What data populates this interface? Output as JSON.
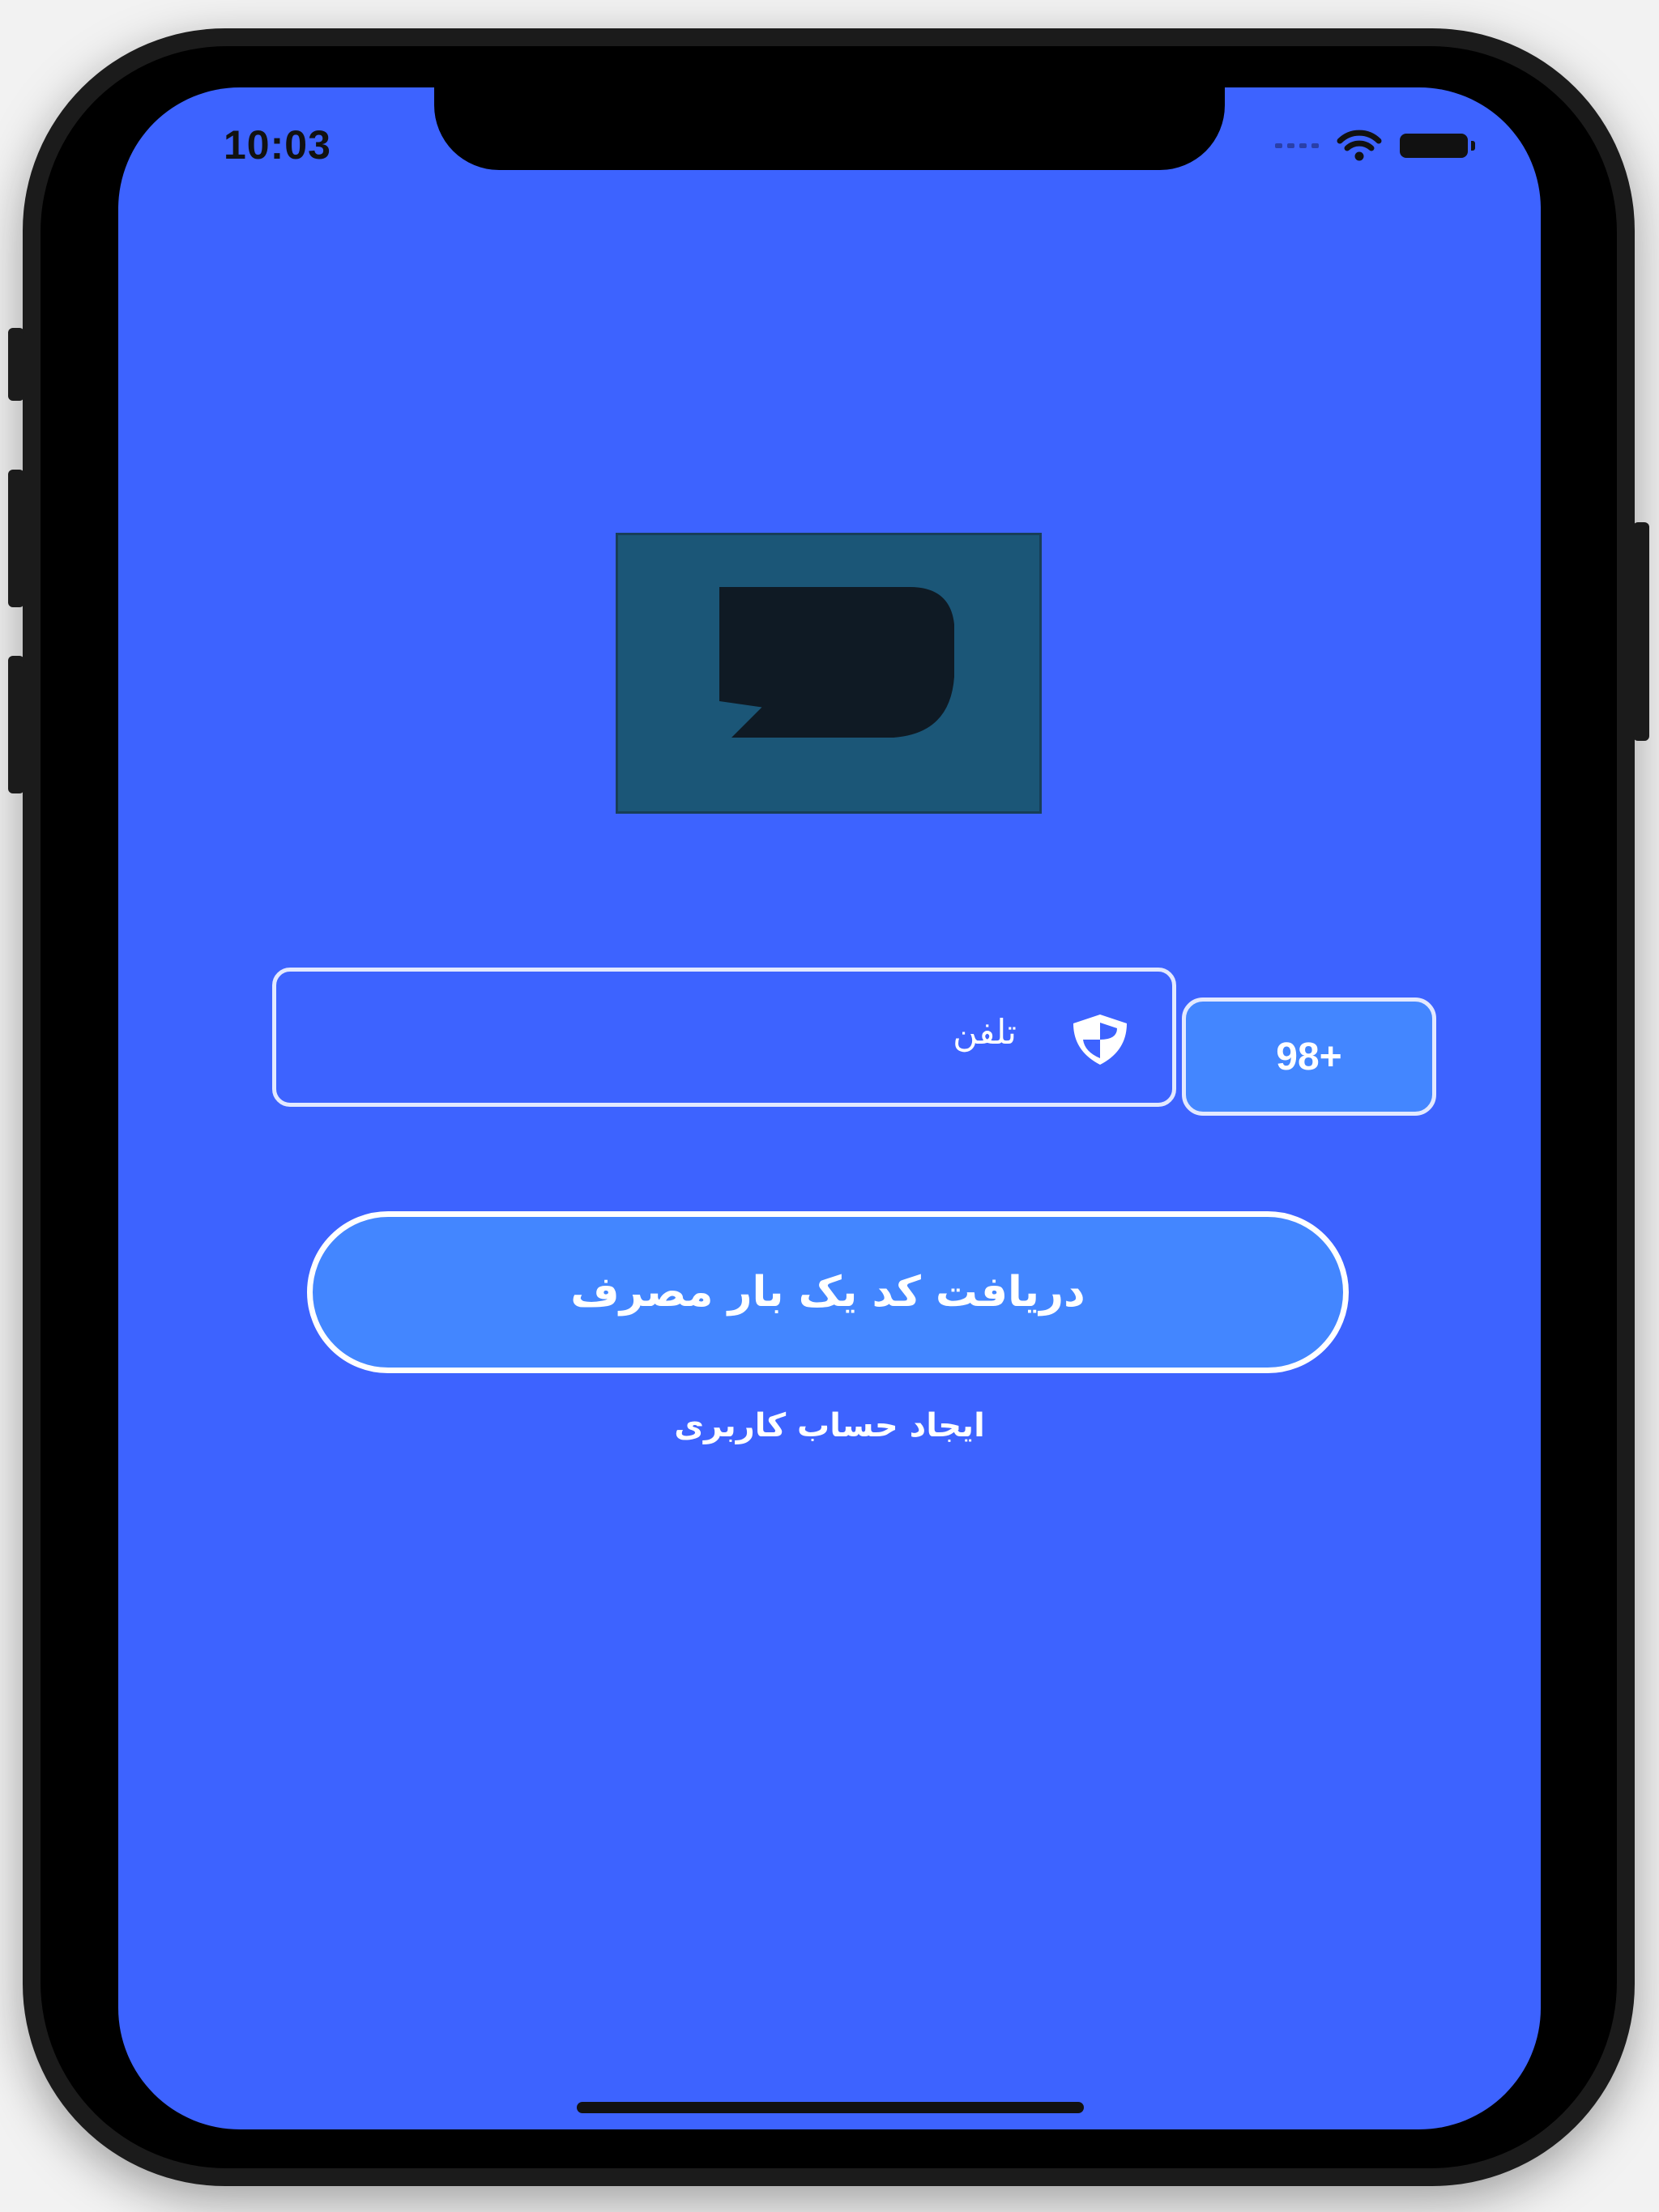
{
  "status_bar": {
    "time": "10:03"
  },
  "login": {
    "phone_placeholder": "تلفن",
    "country_code": "98+",
    "otp_button_label": "دریافت کد یک بار مصرف",
    "register_link_label": "ایجاد حساب کاربری"
  },
  "colors": {
    "screen_background": "#3d63ff",
    "button_fill": "#4386ff",
    "logo_background": "#1b5677",
    "logo_mark": "#0f1a24"
  }
}
